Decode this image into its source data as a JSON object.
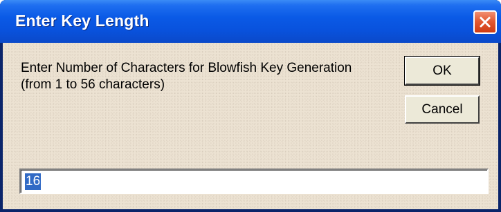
{
  "window": {
    "title": "Enter Key Length",
    "close_icon": "close-icon"
  },
  "dialog": {
    "prompt_line1": "Enter Number of Characters for Blowfish Key Generation",
    "prompt_line2": "(from 1 to 56 characters)",
    "ok_label": "OK",
    "cancel_label": "Cancel",
    "input_value": "16"
  },
  "colors": {
    "titlebar": "#0a5ae6",
    "close_button": "#e25a33",
    "dialog_background": "#ece2d2",
    "selection": "#316ac5"
  }
}
